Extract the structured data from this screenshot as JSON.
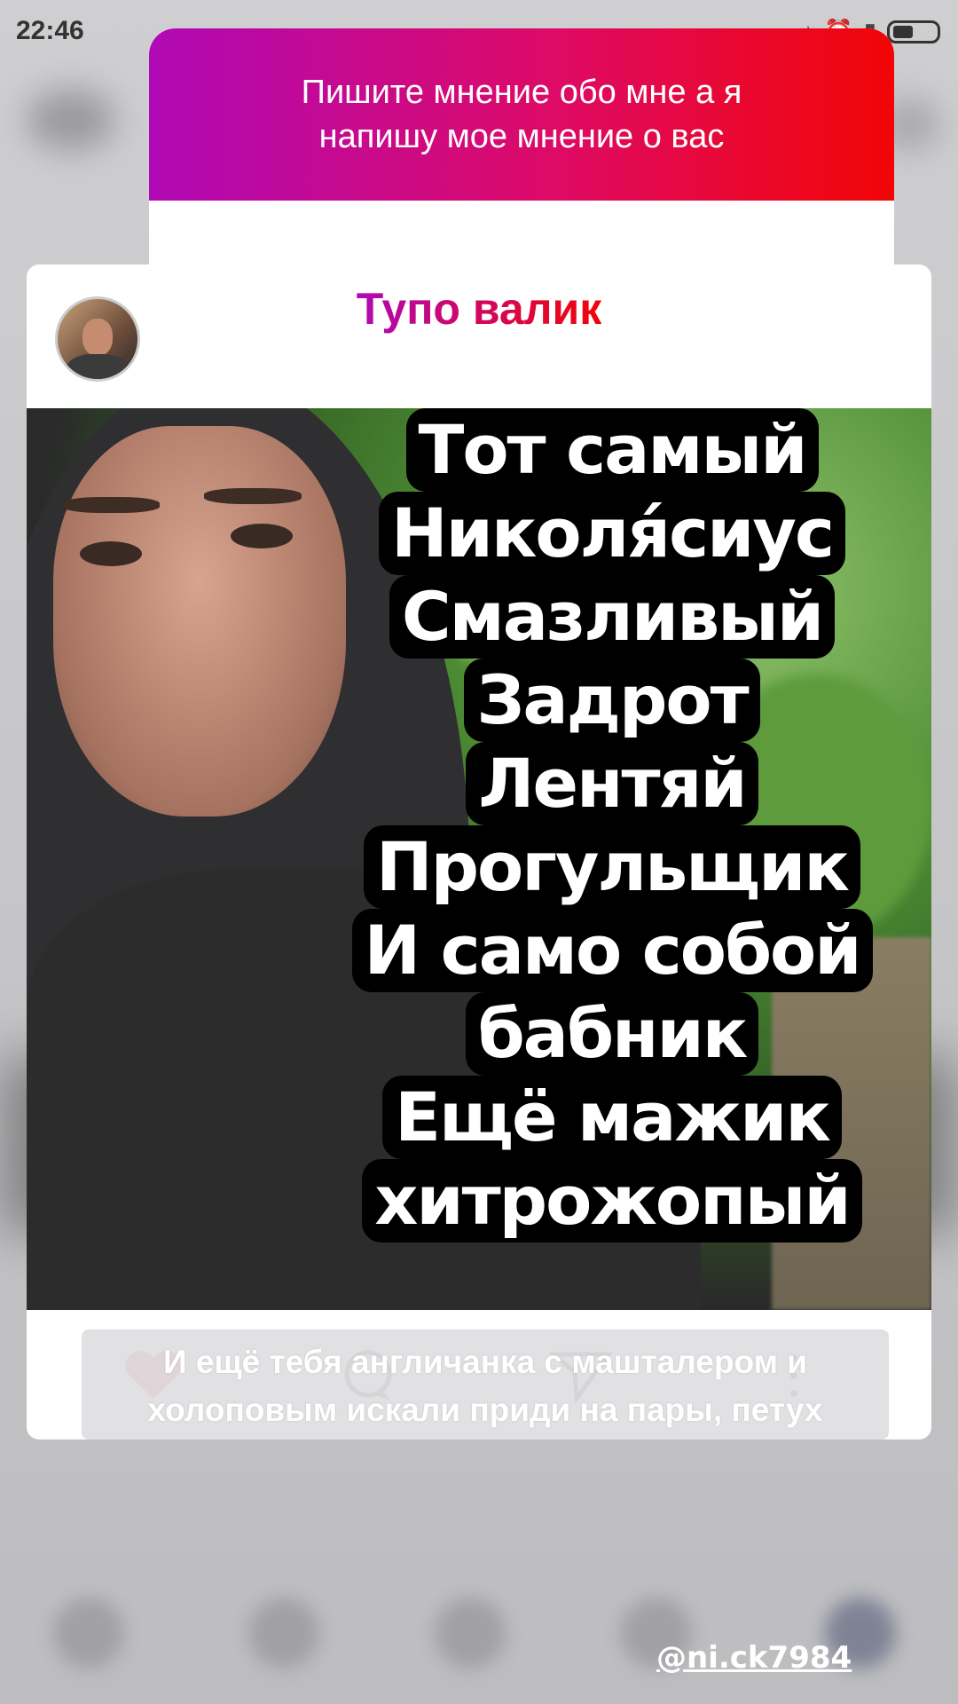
{
  "status_bar": {
    "time": "22:46",
    "network_speed": "",
    "battery_icon": "battery-icon"
  },
  "question_sticker": {
    "text": "Пишите мнение обо мне а я напишу мое мнение о вас"
  },
  "answer": {
    "title": "Тупо валик",
    "overlay_lines": [
      "Тот самый",
      "Николя́сиус",
      "Смазливый",
      "Задрот",
      "Лентяй",
      "Прогульщик",
      "И само собой",
      "бабник",
      "Ещё мажик",
      "хитрожопый"
    ],
    "reply_text": "И ещё тебя англичанка с машталером и холоповым искали приди на пары, петух"
  },
  "mention": {
    "username": "@ni.ck7984"
  },
  "colors": {
    "gradient_start": "#b009b6",
    "gradient_end": "#f20505"
  }
}
